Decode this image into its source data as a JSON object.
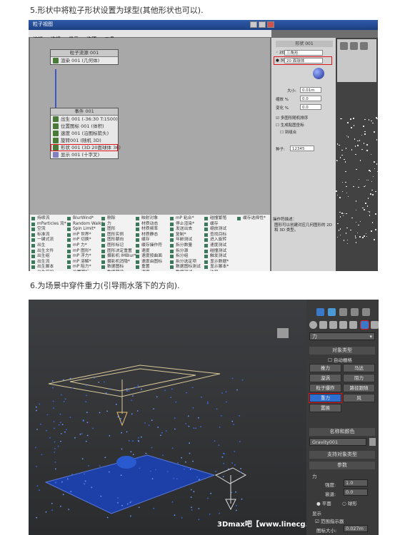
{
  "captions": {
    "step5": "5.形状中将粒子形状设置为球型(其他形状也可以).",
    "step6": "6.为场景中穿件重力(引导雨水落下的方向)."
  },
  "shot1": {
    "window_title": "粒子视图",
    "menu": [
      "编辑",
      "选择",
      "显示",
      "选项",
      "工具"
    ],
    "source_node": {
      "title": "粒子流源 001",
      "rows": [
        "渲染 001 (几何体)"
      ]
    },
    "event_node": {
      "title": "事件 001",
      "rows": [
        "出生 001 (-36:30 T:1500)",
        "位置图标 001 (体积)",
        "速度 001 (沿图标箭头)",
        "旋转001 (随机 3D)",
        "形状 001 (3D 20面球体 36)",
        "显示 001 (十字叉)"
      ]
    },
    "depot_cols": [
      [
        "持续流",
        "mParticles 流*",
        "空流",
        "标准流",
        "一键式流",
        "出生",
        "出生文件",
        "出生组",
        "出生流",
        "出生脚本",
        "出生组织",
        "出生绘制"
      ],
      [
        "BlurWind*",
        "Random Walk*",
        "Spin Limit*",
        "mP 世界*",
        "mP 切换*",
        "mP 力*",
        "mP 图形*",
        "mP 浮力*",
        "mP 溶解*",
        "mP 阻力*",
        "位置图标",
        "位置对象"
      ],
      [
        "删除",
        "力",
        "图形",
        "图形实例",
        "图形朝向",
        "图形标记",
        "图形决定重置",
        "摄影机 IMBlur*",
        "摄影机消隐*",
        "数据图标",
        "数据预设",
        "数据操作符*"
      ],
      [
        "映射对象",
        "材质动态",
        "材质频率",
        "材质静态",
        "缓存",
        "缓存操作符",
        "速度",
        "速度按曲面",
        "速度由图标",
        "重置",
        "速度",
        "速度按曲面"
      ],
      [
        "mP 粘合*",
        "停止渲染*",
        "发送出去",
        "复制*",
        "年龄测试",
        "拆分数量",
        "拆分源",
        "拆分组",
        "拆分选定项",
        "数据图标测试",
        "数据测试",
        "数据预设*"
      ],
      [
        "碰撞繁殖",
        "缓存",
        "缩放测试",
        "查找目标",
        "进入旋转",
        "速度测试",
        "碰撞测试",
        "触发测试",
        "显示数据*",
        "显示脚本*",
        "注释",
        "显示"
      ],
      [
        "缓存选择性*"
      ]
    ],
    "shape_panel": {
      "title": "形状 001",
      "type_2d": "三角形",
      "type_3d": "20 面球体",
      "fields": [
        {
          "label": "大小:",
          "value": "0.01m"
        },
        {
          "label": "缩放 %",
          "value": "0.0"
        },
        {
          "label": "变化 %",
          "value": "0.0"
        }
      ],
      "checks": [
        "多图形随机排序",
        "生成贴图坐标",
        "到组合"
      ],
      "seed_label": "种子:",
      "seed_value": "12345",
      "op_desc": "操作符描述：",
      "op_note": "图形可以创建对应几何图形的 2D 和 3D 类型。"
    }
  },
  "shot2": {
    "object_type_header": "对象类型",
    "auto_grid": "自动栅格",
    "buttons": [
      [
        "推力",
        "马达"
      ],
      [
        "漩涡",
        "阻力"
      ],
      [
        "粒子爆炸",
        "路径跟随"
      ],
      [
        "重力",
        "风"
      ],
      [
        "置换",
        ""
      ]
    ],
    "dropdown_value": "力",
    "name_color_header": "名称和颜色",
    "object_name": "Gravity001",
    "support_header": "支持对象类型",
    "params_header": "参数",
    "force_label": "力",
    "strength_label": "强度:",
    "strength_value": "1.0",
    "decay_label": "衰退:",
    "decay_value": "0.0",
    "radio_plane": "平面",
    "radio_sphere": "球形",
    "display_label": "显示",
    "range_indicator": "范围指示器",
    "icon_size_label": "图标大小:",
    "icon_size_value": "0.027m",
    "watermark": "3Dmax吧【www.linecg.com/tieba/1771】",
    "colors": {
      "blue_plane": "#1c3fa8",
      "highlight": "#e0161b"
    }
  }
}
